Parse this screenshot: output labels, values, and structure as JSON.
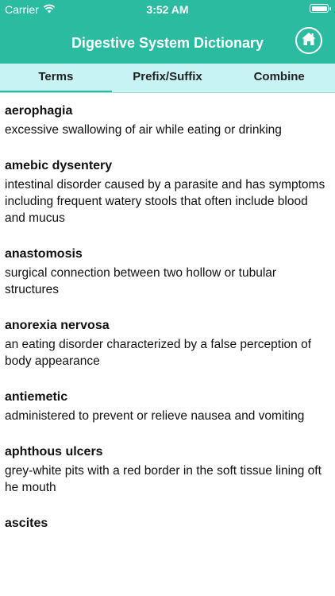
{
  "status_bar": {
    "carrier": "Carrier",
    "time": "3:52 AM"
  },
  "header": {
    "title": "Digestive System Dictionary",
    "home_icon": "home-icon"
  },
  "tabs": [
    {
      "label": "Terms",
      "active": true
    },
    {
      "label": "Prefix/Suffix",
      "active": false
    },
    {
      "label": "Combine",
      "active": false
    }
  ],
  "colors": {
    "header_bg": "#2bbba0",
    "tab_bg": "#c8f3f4"
  },
  "entries": [
    {
      "term": "aerophagia",
      "definition": "excessive swallowing of air while eating or drinking"
    },
    {
      "term": "amebic dysentery",
      "definition": "intestinal disorder caused by a parasite and has symptoms including frequent watery stools that often include blood and mucus"
    },
    {
      "term": "anastomosis",
      "definition": "surgical connection between two hollow or tubular structures"
    },
    {
      "term": "anorexia nervosa",
      "definition": "an eating disorder characterized by a false perception of body appearance"
    },
    {
      "term": "antiemetic",
      "definition": "administered to prevent or relieve nausea and vomiting"
    },
    {
      "term": "aphthous ulcers",
      "definition": "grey-white pits with a red border in the soft tissue lining oft he mouth"
    },
    {
      "term": "ascites",
      "definition": ""
    }
  ]
}
